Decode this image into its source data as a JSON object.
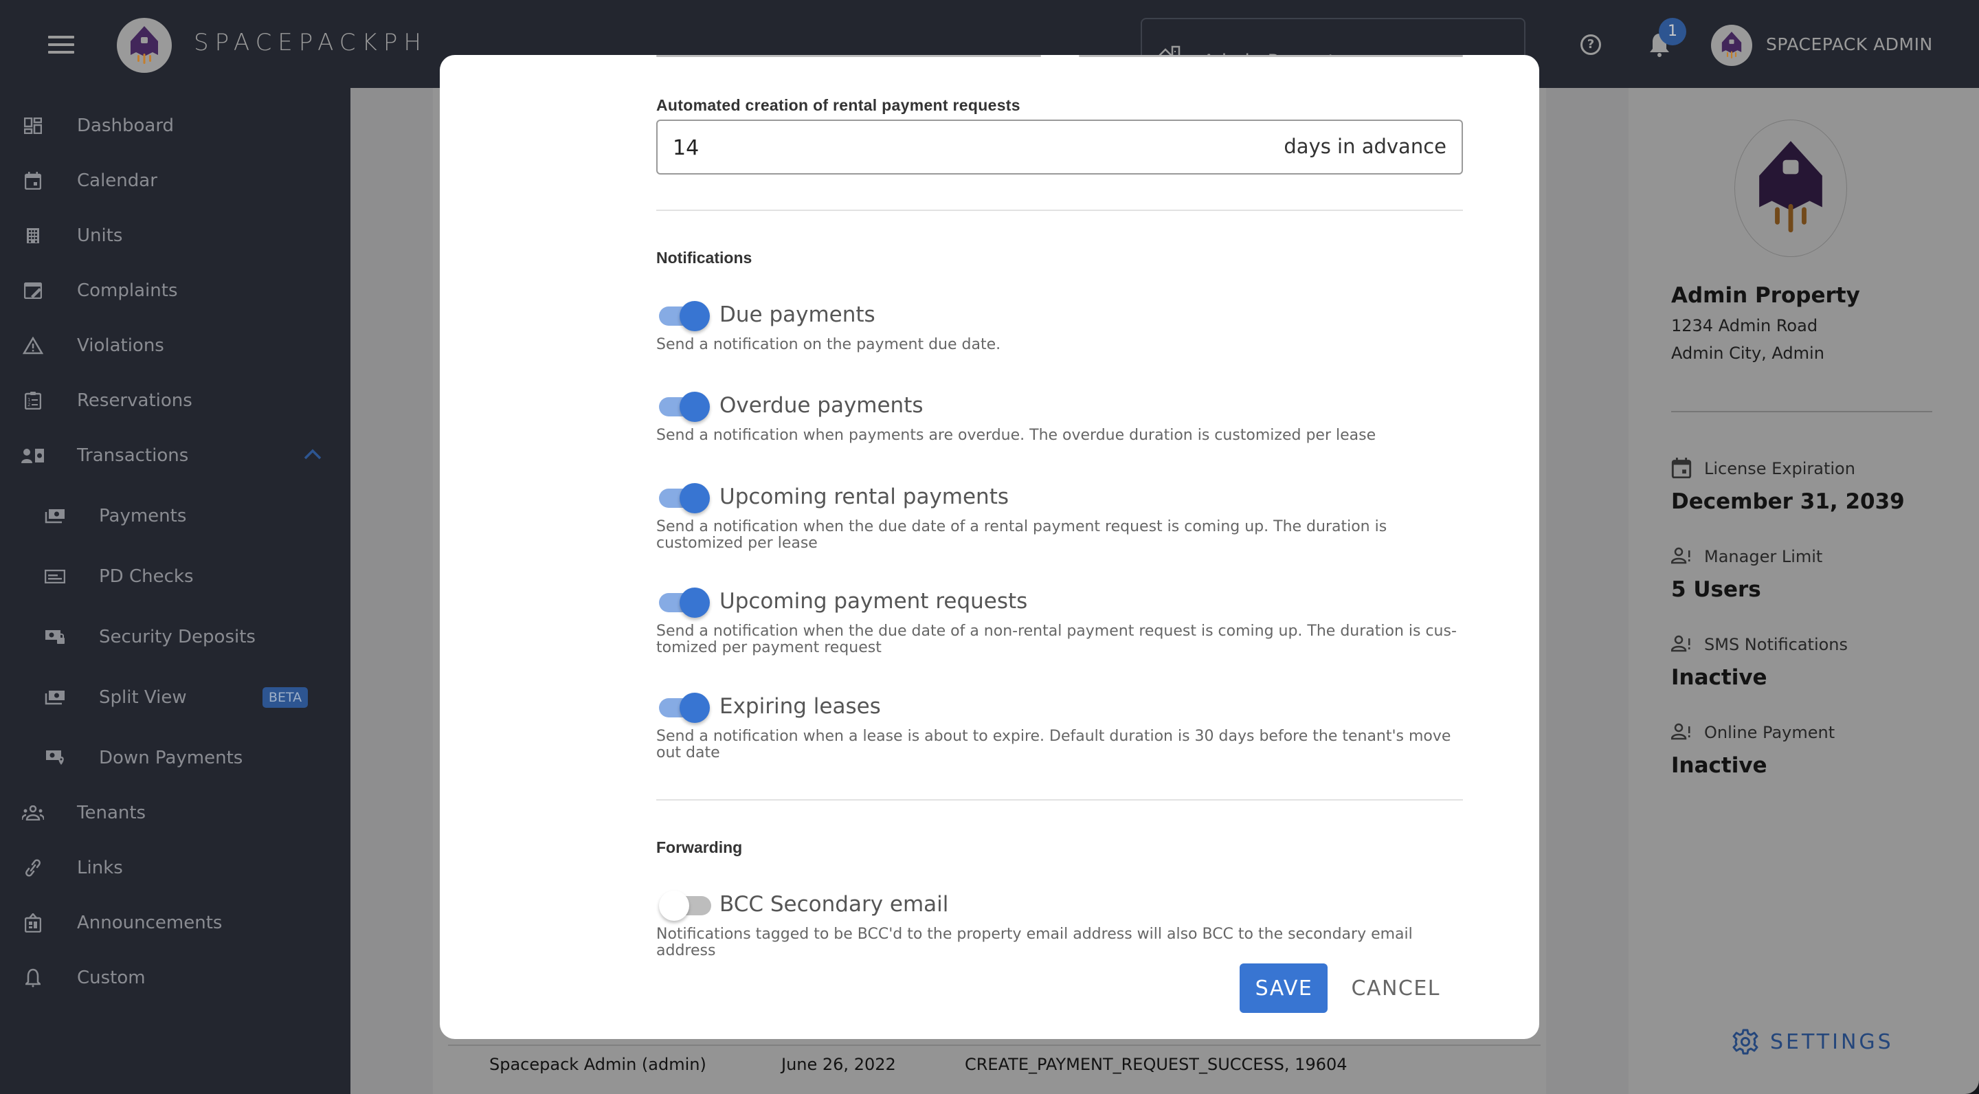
{
  "app": {
    "brand_name": "SPACEPACKPH",
    "property_selector": {
      "selected": "Admin Property"
    },
    "notifications_count": "1",
    "user_name": "SPACEPACK ADMIN"
  },
  "sidebar": {
    "items": [
      {
        "label": "Dashboard",
        "icon": "dashboard-icon"
      },
      {
        "label": "Calendar",
        "icon": "calendar-icon"
      },
      {
        "label": "Units",
        "icon": "building-icon"
      },
      {
        "label": "Complaints",
        "icon": "complaint-icon"
      },
      {
        "label": "Violations",
        "icon": "warning-icon"
      },
      {
        "label": "Reservations",
        "icon": "clipboard-list-icon"
      },
      {
        "label": "Transactions",
        "icon": "transactions-icon",
        "expanded": true
      },
      {
        "label": "Tenants",
        "icon": "people-icon"
      },
      {
        "label": "Links",
        "icon": "link-icon"
      },
      {
        "label": "Announcements",
        "icon": "announcement-icon"
      },
      {
        "label": "Custom",
        "icon": "bell-icon"
      }
    ],
    "transactions_children": [
      {
        "label": "Payments",
        "icon": "money-stack-icon"
      },
      {
        "label": "PD Checks",
        "icon": "check-icon"
      },
      {
        "label": "Security Deposits",
        "icon": "money-lock-icon"
      },
      {
        "label": "Split View",
        "icon": "money-stack-icon",
        "badge": "BETA"
      },
      {
        "label": "Down Payments",
        "icon": "money-pin-icon"
      }
    ]
  },
  "right_panel": {
    "property_name": "Admin Property",
    "address_line1": "1234 Admin Road",
    "address_line2": "Admin City, Admin",
    "stats": [
      {
        "label": "License Expiration",
        "value": "December 31, 2039",
        "icon": "calendar-icon"
      },
      {
        "label": "Manager Limit",
        "value": "5 Users",
        "icon": "user-alert-icon"
      },
      {
        "label": "SMS Notifications",
        "value": "Inactive",
        "icon": "user-alert-icon"
      },
      {
        "label": "Online Payment",
        "value": "Inactive",
        "icon": "user-alert-icon"
      }
    ],
    "settings_label": "SETTINGS"
  },
  "background_log": {
    "user": "Spacepack Admin (admin)",
    "date": "June 26, 2022",
    "event": "CREATE_PAYMENT_REQUEST_SUCCESS, 19604"
  },
  "modal": {
    "auto_creation": {
      "label": "Automated creation of rental payment requests",
      "value": "14",
      "suffix": "days in advance"
    },
    "notifications": {
      "title": "Notifications",
      "toggles": [
        {
          "label": "Due payments",
          "enabled": true,
          "description": "Send a notification on the payment due date."
        },
        {
          "label": "Overdue payments",
          "enabled": true,
          "description": "Send a notification when payments are overdue. The overdue duration is customized per lease"
        },
        {
          "label": "Upcoming rental payments",
          "enabled": true,
          "description": "Send a notification when the due date of a rental payment request is coming up. The duration is customized per lease"
        },
        {
          "label": "Upcoming payment requests",
          "enabled": true,
          "description": "Send a notification when the due date of a non-rental payment request is coming up. The duration is cus-tomized per payment request"
        },
        {
          "label": "Expiring leases",
          "enabled": true,
          "description": "Send a notification when a lease is about to expire. Default duration is 30 days before the tenant's move out date"
        }
      ]
    },
    "forwarding": {
      "title": "Forwarding",
      "toggles": [
        {
          "label": "BCC Secondary email",
          "enabled": false,
          "description": "Notifications tagged to be BCC'd to the property email address will also BCC to the secondary email address"
        }
      ]
    },
    "save_label": "SAVE",
    "cancel_label": "CANCEL"
  },
  "colors": {
    "accent": "#3875d2",
    "sidebar_bg": "#23262f",
    "brand_purple": "#42265a",
    "brand_orange": "#c47f2e"
  }
}
